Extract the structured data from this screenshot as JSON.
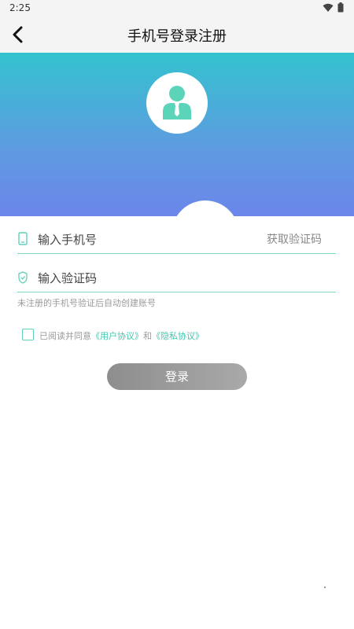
{
  "status_bar": {
    "time": "2:25",
    "icons": [
      "wifi-icon",
      "battery-icon"
    ]
  },
  "app_bar": {
    "title": "手机号登录注册",
    "back_icon": "chevron-left-icon"
  },
  "form": {
    "phone": {
      "placeholder": "输入手机号",
      "get_code_label": "获取验证码"
    },
    "code": {
      "placeholder": "输入验证码"
    },
    "hint": "未注册的手机号验证后自动创建账号"
  },
  "agreement": {
    "checked": false,
    "prefix": "已阅读并同意",
    "user_agreement": "《用户协议》",
    "and": "和",
    "privacy_agreement": "《隐私协议》"
  },
  "login_button": {
    "label": "登录"
  },
  "colors": {
    "accent": "#43c6ad",
    "gradient_top": "#33c3cf",
    "gradient_bottom": "#6b86ea",
    "button": "#999999"
  }
}
